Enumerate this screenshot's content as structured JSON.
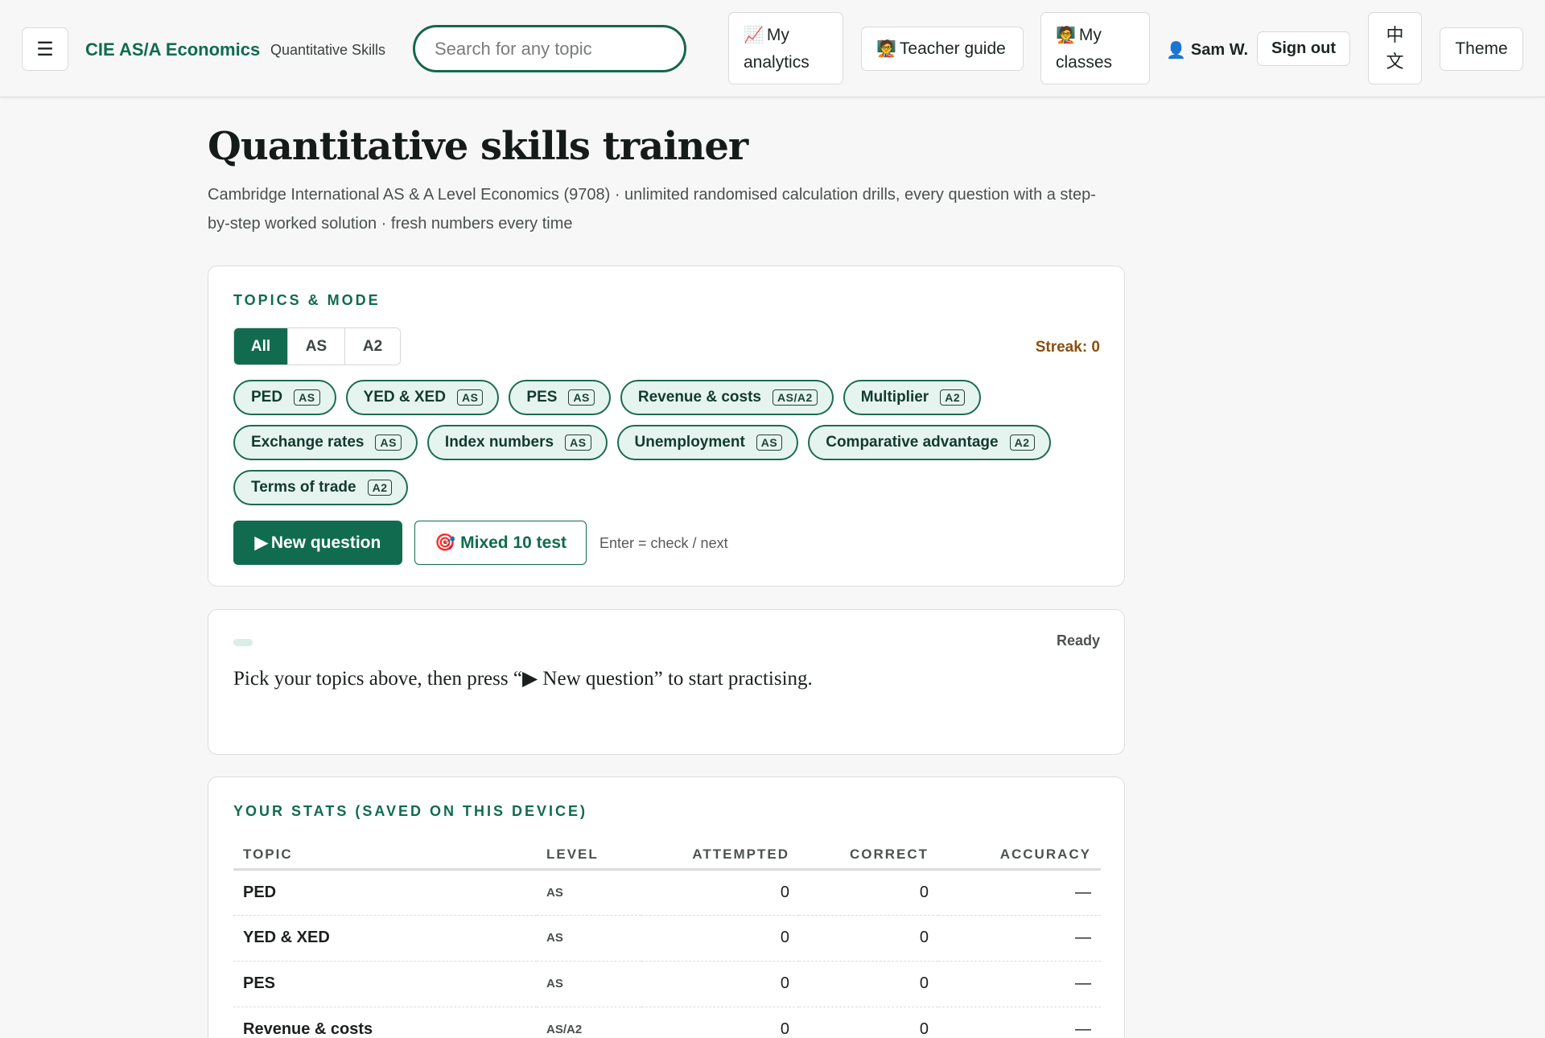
{
  "nav": {
    "menu_icon": "☰",
    "brand": "CIE AS/A Economics",
    "brand_sub": "Quantitative Skills",
    "search_placeholder": "Search for any topic",
    "analytics_emoji": "📈",
    "analytics_line1": "My",
    "analytics_line2": "analytics",
    "guide_emoji": "🧑‍🏫",
    "guide_label": "Teacher guide",
    "classes_emoji": "🧑‍🏫",
    "classes_line1": "My",
    "classes_line2": "classes",
    "user_icon": "👤",
    "user_name": "Sam W.",
    "signout_label": "Sign out",
    "lang_line1": "中",
    "lang_line2": "文",
    "theme_label": "Theme"
  },
  "header": {
    "title": "Quantitative skills trainer",
    "subtitle": "Cambridge International AS & A Level Economics (9708) · unlimited randomised calculation drills, every question with a step-by-step worked solution · fresh numbers every time"
  },
  "topics_card": {
    "title": "TOPICS & MODE",
    "filters": [
      {
        "label": "All",
        "active": true
      },
      {
        "label": "AS",
        "active": false
      },
      {
        "label": "A2",
        "active": false
      }
    ],
    "streak": "Streak: 0",
    "chips": [
      {
        "label": "PED",
        "level": "AS"
      },
      {
        "label": "YED & XED",
        "level": "AS"
      },
      {
        "label": "PES",
        "level": "AS"
      },
      {
        "label": "Revenue & costs",
        "level": "AS/A2"
      },
      {
        "label": "Multiplier",
        "level": "A2"
      },
      {
        "label": "Exchange rates",
        "level": "AS"
      },
      {
        "label": "Index numbers",
        "level": "AS"
      },
      {
        "label": "Unemployment",
        "level": "AS"
      },
      {
        "label": "Comparative advantage",
        "level": "A2"
      },
      {
        "label": "Terms of trade",
        "level": "A2"
      }
    ],
    "new_question_icon": "▶",
    "new_question_label": "New question",
    "mixed_icon": "🎯",
    "mixed_label": "Mixed 10 test",
    "hint": "Enter = check / next"
  },
  "question_card": {
    "status": "Ready",
    "prompt": "Pick your topics above, then press “▶ New question” to start practising."
  },
  "stats": {
    "title": "YOUR STATS (SAVED ON THIS DEVICE)",
    "columns": [
      "TOPIC",
      "LEVEL",
      "ATTEMPTED",
      "CORRECT",
      "ACCURACY"
    ],
    "rows": [
      {
        "topic": "PED",
        "level": "AS",
        "attempted": "0",
        "correct": "0",
        "accuracy": "—"
      },
      {
        "topic": "YED & XED",
        "level": "AS",
        "attempted": "0",
        "correct": "0",
        "accuracy": "—"
      },
      {
        "topic": "PES",
        "level": "AS",
        "attempted": "0",
        "correct": "0",
        "accuracy": "—"
      },
      {
        "topic": "Revenue & costs",
        "level": "AS/A2",
        "attempted": "0",
        "correct": "0",
        "accuracy": "—"
      }
    ]
  },
  "colors": {
    "accent": "#116b4f",
    "chip_bg": "#e6f4ef",
    "streak": "#8a4f0e"
  }
}
